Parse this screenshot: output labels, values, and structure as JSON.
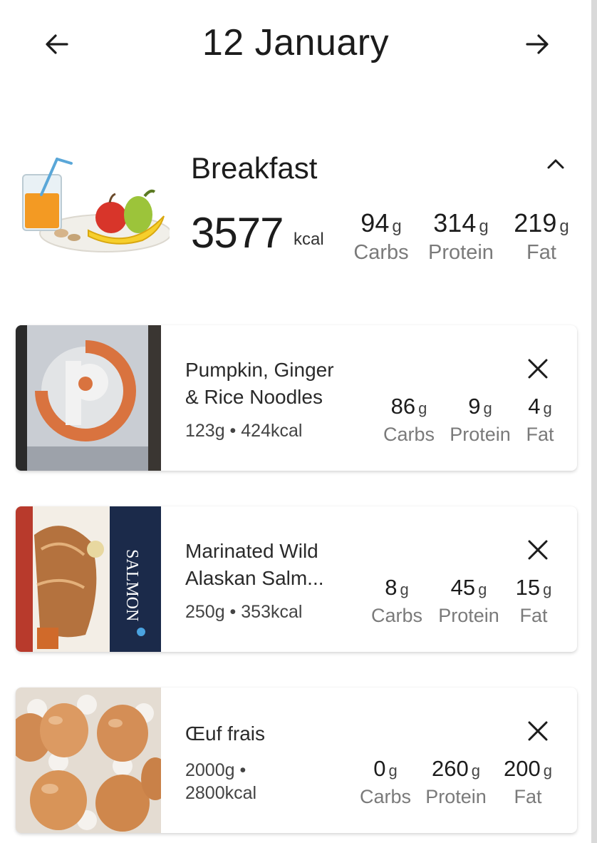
{
  "header": {
    "title": "12 January",
    "prev_icon": "arrow-left-icon",
    "next_icon": "arrow-right-icon"
  },
  "meal": {
    "name": "Breakfast",
    "kcal": "3577",
    "kcal_unit": "kcal",
    "collapse_icon": "chevron-up-icon",
    "illustration_icon": "breakfast-illustration",
    "macros": [
      {
        "value": "94",
        "unit": "g",
        "label": "Carbs"
      },
      {
        "value": "314",
        "unit": "g",
        "label": "Protein"
      },
      {
        "value": "219",
        "unit": "g",
        "label": "Fat"
      }
    ]
  },
  "foods": [
    {
      "name_line1": "Pumpkin, Ginger",
      "name_line2": "& Rice Noodles",
      "meta_line1": "123g • 424kcal",
      "meta_line2": "",
      "thumb_icon": "product-logo-thumbnail",
      "macros": [
        {
          "value": "86",
          "unit": "g",
          "label": "Carbs"
        },
        {
          "value": "9",
          "unit": "g",
          "label": "Protein"
        },
        {
          "value": "4",
          "unit": "g",
          "label": "Fat"
        }
      ]
    },
    {
      "name_line1": "Marinated Wild",
      "name_line2": "Alaskan Salm...",
      "meta_line1": "250g • 353kcal",
      "meta_line2": "",
      "thumb_icon": "salmon-package-thumbnail",
      "thumb_text": "SALMON",
      "macros": [
        {
          "value": "8",
          "unit": "g",
          "label": "Carbs"
        },
        {
          "value": "45",
          "unit": "g",
          "label": "Protein"
        },
        {
          "value": "15",
          "unit": "g",
          "label": "Fat"
        }
      ]
    },
    {
      "name_line1": "Œuf frais",
      "name_line2": "",
      "meta_line1": "2000g •",
      "meta_line2": "2800kcal",
      "thumb_icon": "eggs-thumbnail",
      "macros": [
        {
          "value": "0",
          "unit": "g",
          "label": "Carbs"
        },
        {
          "value": "260",
          "unit": "g",
          "label": "Protein"
        },
        {
          "value": "200",
          "unit": "g",
          "label": "Fat"
        }
      ]
    }
  ],
  "colors": {
    "text": "#1c1c1c",
    "secondary": "#7a7a7a",
    "card_bg": "#ffffff"
  }
}
